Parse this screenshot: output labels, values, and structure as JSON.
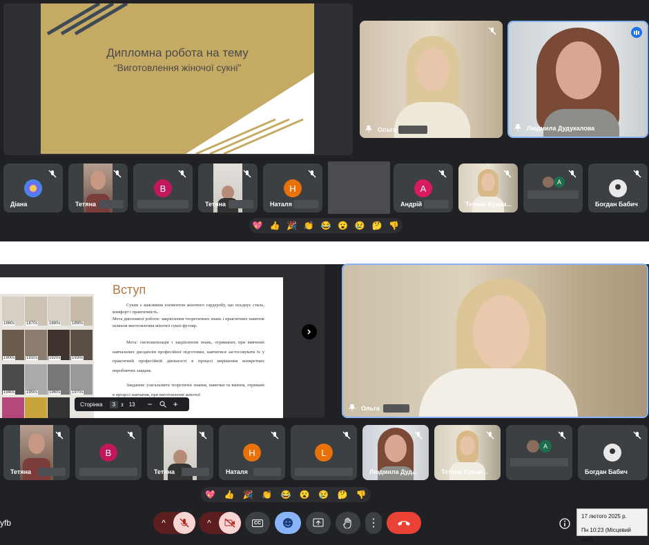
{
  "top_view": {
    "slide": {
      "title_line1": "Дипломна робота на тему",
      "title_line2": "“Виготовлення жіночої сукні”"
    },
    "featured": [
      {
        "name": "Ольга"
      },
      {
        "name": "Людмила Дудукалова"
      }
    ],
    "participants": [
      {
        "name": "Діана"
      },
      {
        "name": "Тетяна"
      },
      {
        "initial": "В"
      },
      {
        "name": "Тетяна"
      },
      {
        "initial": "Н",
        "name": "Наталя"
      },
      {
        "initial": "А",
        "name": "Андрій ."
      },
      {
        "name": "Тетяна Кузьм..."
      },
      {
        "initial": "A"
      },
      {
        "name": "Богдан Бабич"
      }
    ]
  },
  "bottom_view": {
    "slide": {
      "heading": "Вступ",
      "p1": "Сукня є важливим елементом жіночого гардеробу, що поєднує стиль, комфорт і практичність.",
      "p2": "Мета дипломної роботи: закріплення теоретичних знань і практичних навичок шляхом виготовлення жіночої сукні-футляр.",
      "p3": "Мета: систематизація і закріплення знань, отриманих при вивченні навчальних дисциплін професійної підготовки, навчитися застосовувати їх у практичній професійній діяльності в процесі вирішення конкретних виробничих завдань",
      "p4": "Завдання: узагальнити теоретичні знання, навички та вміння, отримані в процесі навчання, при виготовленні жіночої",
      "photo_labels": [
        "1860s",
        "1870s",
        "1880s",
        "1890s",
        "1900s",
        "1910s",
        "1920s",
        "1930s",
        "1940s",
        "1950s",
        "1960s",
        "1970s"
      ],
      "page_label": "Сторінка",
      "page_current": "3",
      "page_of": "з",
      "page_total": "13",
      "zoom_minus": "−",
      "zoom_plus": "+"
    },
    "featured": {
      "name": "Ольга"
    },
    "participants": [
      {
        "name": "Тетяна"
      },
      {
        "initial": "В"
      },
      {
        "name": "Тетяна"
      },
      {
        "initial": "Н",
        "name": "Наталя"
      },
      {
        "initial": "L"
      },
      {
        "name": "Людмила Дуд..."
      },
      {
        "name": "Тетяна Кузьм..."
      },
      {
        "initial": "A"
      },
      {
        "name": "Богдан Бабич"
      }
    ]
  },
  "reactions": [
    "💖",
    "👍",
    "🎉",
    "👏",
    "😂",
    "😮",
    "😢",
    "🤔",
    "👎"
  ],
  "meeting_code": "yfb",
  "toolbar": {
    "captions_label": "CC",
    "chevron": "^",
    "more": "⋮"
  },
  "clock_tooltip": {
    "date": "17 лютого 2025 р.",
    "time": "Пн 10:23 (Місцевий час)"
  },
  "colors": {
    "background": "#202124",
    "tile": "#3c4043",
    "accent_blue": "#8ab4f8",
    "end_call_red": "#ea4335",
    "avatar_pink": "#c2185b",
    "avatar_orange": "#e8710a",
    "avatar_green": "#1e6e4e"
  }
}
